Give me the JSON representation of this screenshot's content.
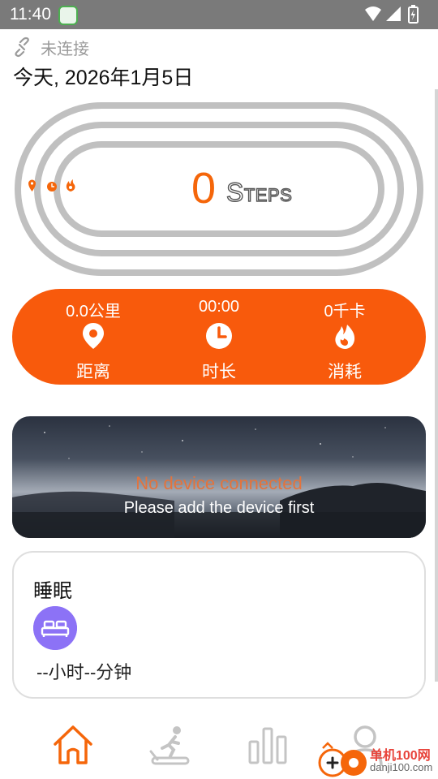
{
  "status_bar": {
    "time": "11:40",
    "icons": [
      "app-notification-icon",
      "wifi-icon",
      "signal-icon",
      "battery-icon"
    ]
  },
  "connection": {
    "icon": "broken-link-icon",
    "label": "未连接"
  },
  "date": "今天, 2026年1月5日",
  "steps": {
    "value": "0",
    "unit": "Steps",
    "markers": [
      "location-marker-icon",
      "clock-marker-icon",
      "flame-marker-icon"
    ]
  },
  "stats": [
    {
      "value": "0.0公里",
      "label": "距离",
      "icon": "location-pin-icon"
    },
    {
      "value": "00:00",
      "label": "时长",
      "icon": "clock-icon"
    },
    {
      "value": "0千卡",
      "label": "消耗",
      "icon": "flame-icon"
    }
  ],
  "device": {
    "title": "No device connected",
    "subtitle": "Please add the device first"
  },
  "sleep": {
    "title": "睡眠",
    "icon": "bed-icon",
    "value": "--小时--分钟"
  },
  "bottom_nav": [
    {
      "icon": "home-icon",
      "active": true
    },
    {
      "icon": "treadmill-icon",
      "active": false
    },
    {
      "icon": "bar-chart-icon",
      "active": false
    },
    {
      "icon": "profile-icon",
      "active": false
    }
  ],
  "watermark": {
    "line1": "单机100网",
    "line2": "danji100.com"
  },
  "colors": {
    "accent": "#f85a0c",
    "sleep_purple": "#8c72f6",
    "track_gray": "#c0c0c0",
    "status_bar": "#7a7a7a"
  }
}
